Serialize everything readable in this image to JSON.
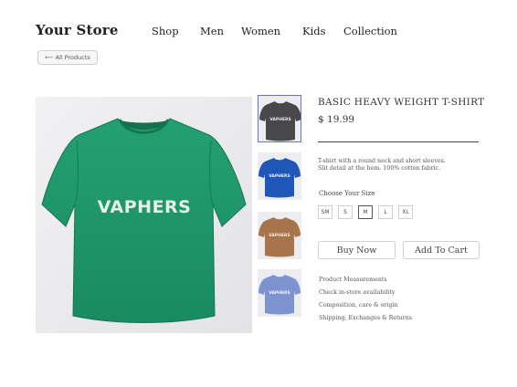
{
  "header": {
    "logo": "Your Store",
    "nav": [
      {
        "label": "Shop"
      },
      {
        "label": "Men"
      },
      {
        "label": "Women"
      },
      {
        "label": "Kids"
      },
      {
        "label": "Collection"
      }
    ]
  },
  "back_button": {
    "arrow": "⟵",
    "label": "All Products"
  },
  "product": {
    "title": "BASIC HEAVY WEIGHT T-SHIRT",
    "price": "$ 19.99",
    "description_line1": "T-shirt with a round neck and short sleeves.",
    "description_line2": "Slit detail at the hem. 100% cotton fabric.",
    "brand_print": "VAPHERS",
    "main_color": "#1f9468",
    "thumbnails": [
      {
        "color": "#48484a",
        "print": "VAPHERS",
        "selected": true
      },
      {
        "color": "#1f57b8",
        "print": "VAPHERS",
        "selected": false
      },
      {
        "color": "#a8744b",
        "print": "VAPHERS",
        "selected": false
      },
      {
        "color": "#7d93cf",
        "print": "VAPHERS",
        "selected": false
      }
    ]
  },
  "size_picker": {
    "label": "Choose Your Size",
    "sizes": [
      "SM",
      "S",
      "M",
      "L",
      "XL"
    ],
    "selected": "M"
  },
  "actions": {
    "buy_now": "Buy Now",
    "add_to_cart": "Add To Cart"
  },
  "info_links": [
    "Product Measurements",
    "Check in-store availability",
    "Composition, care & origin",
    "Shipping, Exchanges & Returns"
  ],
  "colors": {
    "accent_selected_border": "#6a6fd8",
    "text": "#2b2b2b"
  }
}
